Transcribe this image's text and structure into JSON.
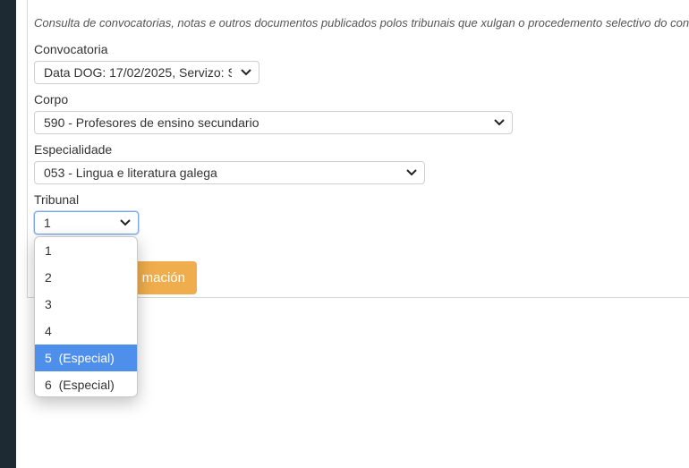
{
  "description": "Consulta de convocatorias, notas e outros documentos publicados polos tribunais que xulgan o procedemento selectivo do concurso",
  "convocatoria": {
    "label": "Convocatoria",
    "value": "Data DOG: 17/02/2025, Servizo: S"
  },
  "corpo": {
    "label": "Corpo",
    "value": "590 - Profesores de ensino secundario"
  },
  "especialidade": {
    "label": "Especialidade",
    "value": "053 - Lingua e literatura galega"
  },
  "tribunal": {
    "label": "Tribunal",
    "value": "1",
    "options": [
      "1",
      "2",
      "3",
      "4",
      "5  (Especial)",
      "6  (Especial)"
    ],
    "highlighted_index": 4
  },
  "submit_button": {
    "label_visible": "mación"
  },
  "colors": {
    "accent": "#efad4d",
    "highlight": "#4f8fec",
    "sidebar": "#1d2a33"
  }
}
